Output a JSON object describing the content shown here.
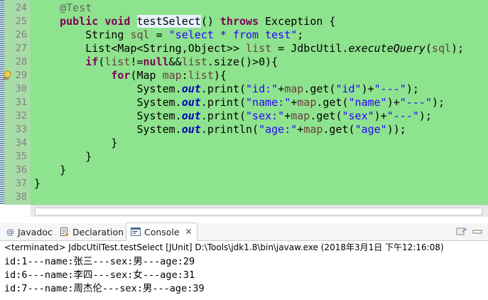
{
  "editor": {
    "lines": [
      {
        "num": "24",
        "segs": [
          {
            "t": "    "
          },
          {
            "t": "@Test",
            "c": "ann"
          }
        ]
      },
      {
        "num": "25",
        "segs": [
          {
            "t": "    "
          },
          {
            "t": "public",
            "c": "kw"
          },
          {
            "t": " "
          },
          {
            "t": "void",
            "c": "kw"
          },
          {
            "t": " "
          },
          {
            "t": "testSelect",
            "c": "hl"
          },
          {
            "t": "() "
          },
          {
            "t": "throws",
            "c": "kw"
          },
          {
            "t": " Exception {"
          }
        ]
      },
      {
        "num": "26",
        "segs": [
          {
            "t": "        String "
          },
          {
            "t": "sql",
            "c": "var"
          },
          {
            "t": " = "
          },
          {
            "t": "\"select * from test\"",
            "c": "str"
          },
          {
            "t": ";"
          }
        ]
      },
      {
        "num": "27",
        "segs": [
          {
            "t": "        List<Map<String,Object>> "
          },
          {
            "t": "list",
            "c": "var"
          },
          {
            "t": " = JdbcUtil."
          },
          {
            "t": "executeQuery",
            "c": "stat"
          },
          {
            "t": "("
          },
          {
            "t": "sql",
            "c": "var"
          },
          {
            "t": ");"
          }
        ]
      },
      {
        "num": "28",
        "segs": [
          {
            "t": "        "
          },
          {
            "t": "if",
            "c": "kw"
          },
          {
            "t": "("
          },
          {
            "t": "list",
            "c": "var"
          },
          {
            "t": "!="
          },
          {
            "t": "null",
            "c": "kw"
          },
          {
            "t": "&&"
          },
          {
            "t": "list",
            "c": "var"
          },
          {
            "t": ".size()>0){"
          }
        ]
      },
      {
        "num": "29",
        "warn": true,
        "segs": [
          {
            "t": "            "
          },
          {
            "t": "for",
            "c": "kw"
          },
          {
            "t": "(Map "
          },
          {
            "t": "map",
            "c": "var"
          },
          {
            "t": ":"
          },
          {
            "t": "list",
            "c": "var"
          },
          {
            "t": "){"
          }
        ]
      },
      {
        "num": "30",
        "segs": [
          {
            "t": "                System."
          },
          {
            "t": "out",
            "c": "fld"
          },
          {
            "t": ".print("
          },
          {
            "t": "\"id:\"",
            "c": "str"
          },
          {
            "t": "+"
          },
          {
            "t": "map",
            "c": "var"
          },
          {
            "t": ".get("
          },
          {
            "t": "\"id\"",
            "c": "str"
          },
          {
            "t": ")+"
          },
          {
            "t": "\"---\"",
            "c": "str"
          },
          {
            "t": ");"
          }
        ]
      },
      {
        "num": "31",
        "segs": [
          {
            "t": "                System."
          },
          {
            "t": "out",
            "c": "fld"
          },
          {
            "t": ".print("
          },
          {
            "t": "\"name:\"",
            "c": "str"
          },
          {
            "t": "+"
          },
          {
            "t": "map",
            "c": "var"
          },
          {
            "t": ".get("
          },
          {
            "t": "\"name\"",
            "c": "str"
          },
          {
            "t": ")+"
          },
          {
            "t": "\"---\"",
            "c": "str"
          },
          {
            "t": ");"
          }
        ]
      },
      {
        "num": "32",
        "segs": [
          {
            "t": "                System."
          },
          {
            "t": "out",
            "c": "fld"
          },
          {
            "t": ".print("
          },
          {
            "t": "\"sex:\"",
            "c": "str"
          },
          {
            "t": "+"
          },
          {
            "t": "map",
            "c": "var"
          },
          {
            "t": ".get("
          },
          {
            "t": "\"sex\"",
            "c": "str"
          },
          {
            "t": ")+"
          },
          {
            "t": "\"---\"",
            "c": "str"
          },
          {
            "t": ");"
          }
        ]
      },
      {
        "num": "33",
        "segs": [
          {
            "t": "                System."
          },
          {
            "t": "out",
            "c": "fld"
          },
          {
            "t": ".println("
          },
          {
            "t": "\"age:\"",
            "c": "str"
          },
          {
            "t": "+"
          },
          {
            "t": "map",
            "c": "var"
          },
          {
            "t": ".get("
          },
          {
            "t": "\"age\"",
            "c": "str"
          },
          {
            "t": "));"
          }
        ]
      },
      {
        "num": "34",
        "segs": [
          {
            "t": "            }"
          }
        ]
      },
      {
        "num": "35",
        "segs": [
          {
            "t": "        }"
          }
        ]
      },
      {
        "num": "36",
        "segs": [
          {
            "t": "    }"
          }
        ]
      },
      {
        "num": "37",
        "segs": [
          {
            "t": "}"
          }
        ]
      },
      {
        "num": "38",
        "segs": []
      }
    ],
    "colors": {
      "code_bg": "#8ee38e",
      "keyword": "#7f0055",
      "string": "#2a00ff",
      "field": "#0000c0",
      "local_var": "#6a3e3e",
      "annotation": "#646464"
    },
    "warning_marker_icon": "warning-lightbulb-icon"
  },
  "panel": {
    "tabs": [
      {
        "label": "Javadoc",
        "icon": "javadoc-at-icon"
      },
      {
        "label": "Declaration",
        "icon": "declaration-icon"
      },
      {
        "label": "Console",
        "icon": "console-icon",
        "active": true
      }
    ],
    "toolbar_icons": [
      "pin-console-icon",
      "minimize-icon"
    ],
    "terminated_label": "<terminated> JdbcUtilTest.testSelect [JUnit] D:\\Tools\\jdk1.8\\bin\\javaw.exe (2018年3月1日 下午12:16:08)",
    "output": [
      "id:1---name:张三---sex:男---age:29",
      "id:6---name:李四---sex:女---age:31",
      "id:7---name:周杰伦---sex:男---age:39"
    ]
  }
}
